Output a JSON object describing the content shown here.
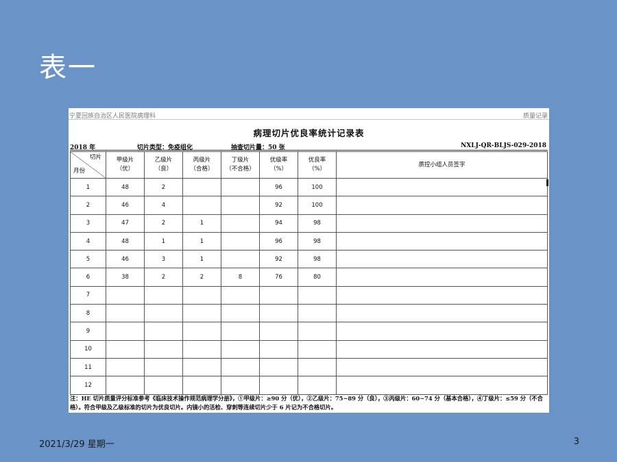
{
  "slide": {
    "title": "表一",
    "date": "2021/3/29 星期一",
    "page_number": "3"
  },
  "document": {
    "header_left": "宁夏回族自治区人民医院病理科",
    "header_right": "质量记录",
    "title": "病理切片优良率统计记录表",
    "year": "2018 年",
    "slide_type": "切片类型：免疫组化",
    "sample_count": "抽查切片量：50 张",
    "code": "NXLJ-QR-BLJS-029-2018",
    "table": {
      "corner_top": "切片",
      "corner_bottom": "月份",
      "columns": [
        [
          "甲级片",
          "（优）"
        ],
        [
          "乙级片",
          "（良）"
        ],
        [
          "丙级片",
          "（合格）"
        ],
        [
          "丁级片",
          "（不合格）"
        ],
        [
          "优级率",
          "（%）"
        ],
        [
          "优良率",
          "（%）"
        ],
        [
          "质控小组人员签字"
        ]
      ],
      "rows": [
        {
          "month": "1",
          "cells": [
            "48",
            "2",
            "",
            "",
            "96",
            "100",
            ""
          ]
        },
        {
          "month": "2",
          "cells": [
            "46",
            "4",
            "",
            "",
            "92",
            "100",
            ""
          ]
        },
        {
          "month": "3",
          "cells": [
            "47",
            "2",
            "1",
            "",
            "94",
            "98",
            ""
          ]
        },
        {
          "month": "4",
          "cells": [
            "48",
            "1",
            "1",
            "",
            "96",
            "98",
            ""
          ]
        },
        {
          "month": "5",
          "cells": [
            "46",
            "3",
            "1",
            "",
            "92",
            "98",
            ""
          ]
        },
        {
          "month": "6",
          "cells": [
            "38",
            "2",
            "2",
            "8",
            "76",
            "80",
            ""
          ]
        },
        {
          "month": "7",
          "cells": [
            "",
            "",
            "",
            "",
            "",
            "",
            ""
          ]
        },
        {
          "month": "8",
          "cells": [
            "",
            "",
            "",
            "",
            "",
            "",
            ""
          ]
        },
        {
          "month": "9",
          "cells": [
            "",
            "",
            "",
            "",
            "",
            "",
            ""
          ]
        },
        {
          "month": "10",
          "cells": [
            "",
            "",
            "",
            "",
            "",
            "",
            ""
          ]
        },
        {
          "month": "11",
          "cells": [
            "",
            "",
            "",
            "",
            "",
            "",
            ""
          ]
        },
        {
          "month": "12",
          "cells": [
            "",
            "",
            "",
            "",
            "",
            "",
            ""
          ]
        }
      ]
    },
    "note": "注：HE 切片质量评分标准参考《临床技术操作规范病理学分册》，①甲级片：≥90 分（优），②乙级片：75~89 分（良），③丙级片：60~74 分（基本合格），④丁级片：≤59 分（不合格）。符合甲级及乙级标准的切片为优良切片。内镜小的活检、穿刺等连续切片少于 6 片记为不合格切片。"
  }
}
